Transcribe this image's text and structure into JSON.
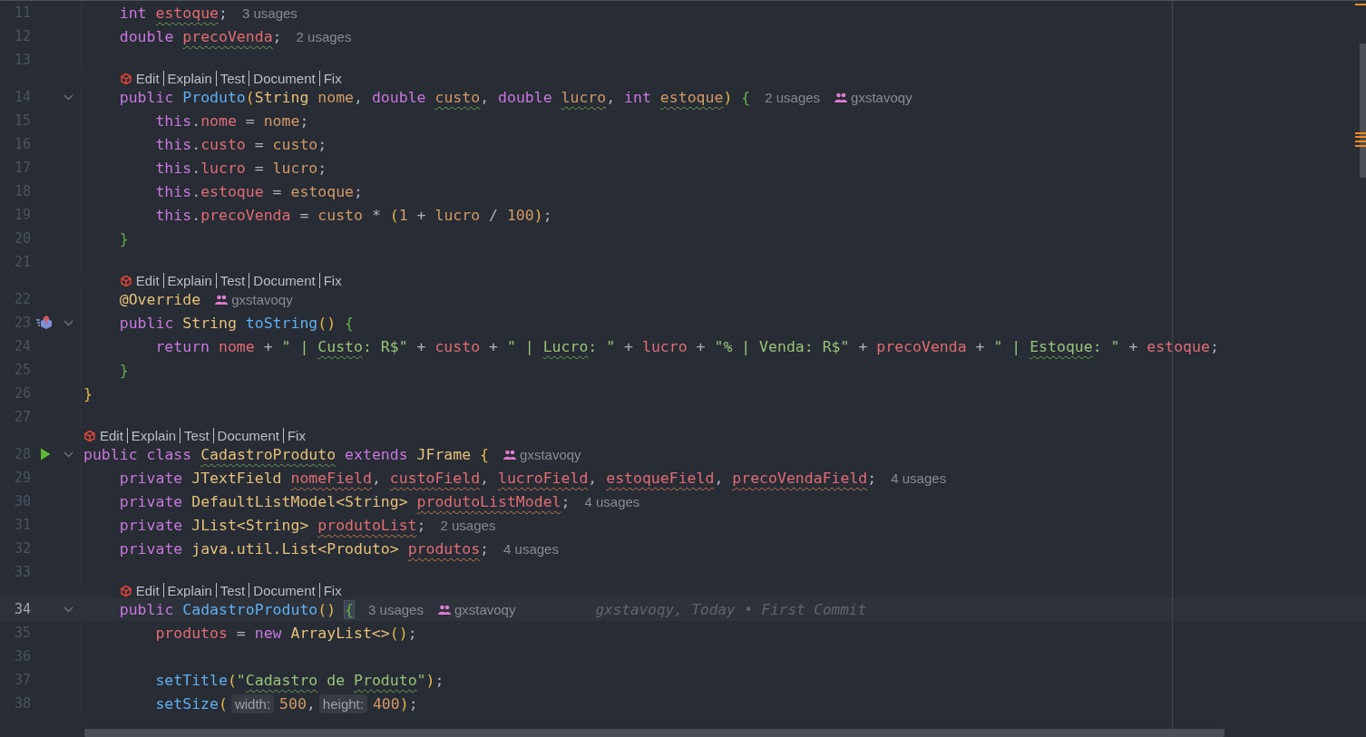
{
  "editor": {
    "lines": [
      {
        "kind": "code",
        "number": "11",
        "foldable": false,
        "current": false,
        "parts": [
          {
            "kind": "code",
            "tokens": [
              {
                "text": "    int ",
                "kind": "keyword"
              },
              {
                "text": "estoque",
                "kind": "field",
                "misspelled": true
              },
              {
                "text": ";",
                "kind": "plain"
              }
            ]
          },
          {
            "kind": "usages",
            "text": "3 usages"
          }
        ]
      },
      {
        "kind": "code",
        "number": "12",
        "foldable": false,
        "current": false,
        "parts": [
          {
            "kind": "code",
            "tokens": [
              {
                "text": "    double ",
                "kind": "keyword"
              },
              {
                "text": "precoVenda",
                "kind": "field",
                "misspelled": true
              },
              {
                "text": ";",
                "kind": "plain"
              }
            ]
          },
          {
            "kind": "usages",
            "text": "2 usages"
          }
        ]
      },
      {
        "kind": "code",
        "number": "13",
        "foldable": false,
        "current": false
      },
      {
        "kind": "lens",
        "actions": [
          "Edit",
          "Explain",
          "Test",
          "Document",
          "Fix"
        ]
      },
      {
        "kind": "code",
        "number": "14",
        "foldable": true,
        "current": false,
        "parts": [
          {
            "kind": "code",
            "tokens": [
              {
                "text": "    public ",
                "kind": "keyword"
              },
              {
                "text": "Produto",
                "kind": "method"
              },
              {
                "text": "(",
                "kind": "bracket"
              },
              {
                "text": "String ",
                "kind": "type"
              },
              {
                "text": "nome",
                "kind": "param"
              },
              {
                "text": ", ",
                "kind": "plain"
              },
              {
                "text": "double ",
                "kind": "keyword"
              },
              {
                "text": "custo",
                "kind": "param",
                "misspelled": true
              },
              {
                "text": ", ",
                "kind": "plain"
              },
              {
                "text": "double ",
                "kind": "keyword"
              },
              {
                "text": "lucro",
                "kind": "param",
                "misspelled": true
              },
              {
                "text": ", ",
                "kind": "plain"
              },
              {
                "text": "int ",
                "kind": "keyword"
              },
              {
                "text": "estoque",
                "kind": "param",
                "misspelled": true
              },
              {
                "text": ") ",
                "kind": "bracket"
              },
              {
                "text": "{",
                "kind": "brace"
              }
            ]
          },
          {
            "kind": "usages",
            "text": "2 usages"
          },
          {
            "kind": "author",
            "text": "gxstavoqy"
          }
        ]
      },
      {
        "kind": "code",
        "number": "15",
        "foldable": false,
        "current": false,
        "parts": [
          {
            "kind": "code",
            "tokens": [
              {
                "text": "        this",
                "kind": "keyword"
              },
              {
                "text": ".",
                "kind": "plain"
              },
              {
                "text": "nome",
                "kind": "field"
              },
              {
                "text": " = ",
                "kind": "plain"
              },
              {
                "text": "nome",
                "kind": "param"
              },
              {
                "text": ";",
                "kind": "plain"
              }
            ]
          }
        ]
      },
      {
        "kind": "code",
        "number": "16",
        "foldable": false,
        "current": false,
        "parts": [
          {
            "kind": "code",
            "tokens": [
              {
                "text": "        this",
                "kind": "keyword"
              },
              {
                "text": ".",
                "kind": "plain"
              },
              {
                "text": "custo",
                "kind": "field"
              },
              {
                "text": " = ",
                "kind": "plain"
              },
              {
                "text": "custo",
                "kind": "param"
              },
              {
                "text": ";",
                "kind": "plain"
              }
            ]
          }
        ]
      },
      {
        "kind": "code",
        "number": "17",
        "foldable": false,
        "current": false,
        "parts": [
          {
            "kind": "code",
            "tokens": [
              {
                "text": "        this",
                "kind": "keyword"
              },
              {
                "text": ".",
                "kind": "plain"
              },
              {
                "text": "lucro",
                "kind": "field"
              },
              {
                "text": " = ",
                "kind": "plain"
              },
              {
                "text": "lucro",
                "kind": "param"
              },
              {
                "text": ";",
                "kind": "plain"
              }
            ]
          }
        ]
      },
      {
        "kind": "code",
        "number": "18",
        "foldable": false,
        "current": false,
        "parts": [
          {
            "kind": "code",
            "tokens": [
              {
                "text": "        this",
                "kind": "keyword"
              },
              {
                "text": ".",
                "kind": "plain"
              },
              {
                "text": "estoque",
                "kind": "field"
              },
              {
                "text": " = ",
                "kind": "plain"
              },
              {
                "text": "estoque",
                "kind": "param"
              },
              {
                "text": ";",
                "kind": "plain"
              }
            ]
          }
        ]
      },
      {
        "kind": "code",
        "number": "19",
        "foldable": false,
        "current": false,
        "parts": [
          {
            "kind": "code",
            "tokens": [
              {
                "text": "        this",
                "kind": "keyword"
              },
              {
                "text": ".",
                "kind": "plain"
              },
              {
                "text": "precoVenda",
                "kind": "field"
              },
              {
                "text": " = ",
                "kind": "plain"
              },
              {
                "text": "custo ",
                "kind": "param"
              },
              {
                "text": "* ",
                "kind": "plain"
              },
              {
                "text": "(",
                "kind": "bracket"
              },
              {
                "text": "1 ",
                "kind": "number"
              },
              {
                "text": "+ ",
                "kind": "plain"
              },
              {
                "text": "lucro ",
                "kind": "param"
              },
              {
                "text": "/ ",
                "kind": "plain"
              },
              {
                "text": "100",
                "kind": "number"
              },
              {
                "text": ")",
                "kind": "bracket"
              },
              {
                "text": ";",
                "kind": "plain"
              }
            ]
          }
        ]
      },
      {
        "kind": "code",
        "number": "20",
        "foldable": false,
        "current": false,
        "parts": [
          {
            "kind": "code",
            "tokens": [
              {
                "text": "    }",
                "kind": "brace"
              }
            ]
          }
        ]
      },
      {
        "kind": "code",
        "number": "21",
        "foldable": false,
        "current": false
      },
      {
        "kind": "lens",
        "actions": [
          "Edit",
          "Explain",
          "Test",
          "Document",
          "Fix"
        ]
      },
      {
        "kind": "code",
        "number": "22",
        "foldable": false,
        "current": false,
        "parts": [
          {
            "kind": "code",
            "tokens": [
              {
                "text": "    @Override",
                "kind": "annotation"
              }
            ]
          },
          {
            "kind": "author",
            "text": "gxstavoqy"
          }
        ]
      },
      {
        "kind": "code",
        "number": "23",
        "foldable": true,
        "current": false,
        "gutter_icon": {
          "kind": "override"
        },
        "parts": [
          {
            "kind": "code",
            "tokens": [
              {
                "text": "    public ",
                "kind": "keyword"
              },
              {
                "text": "String ",
                "kind": "type"
              },
              {
                "text": "toString",
                "kind": "method"
              },
              {
                "text": "() ",
                "kind": "bracket"
              },
              {
                "text": "{",
                "kind": "brace"
              }
            ]
          }
        ]
      },
      {
        "kind": "code",
        "number": "24",
        "foldable": false,
        "current": false,
        "parts": [
          {
            "kind": "code",
            "tokens": [
              {
                "text": "        return ",
                "kind": "keyword"
              },
              {
                "text": "nome ",
                "kind": "field"
              },
              {
                "text": "+ ",
                "kind": "plain"
              },
              {
                "text": "\" | ",
                "kind": "string"
              },
              {
                "text": "Custo",
                "kind": "string",
                "misspelled": true
              },
              {
                "text": ": R$\" ",
                "kind": "string"
              },
              {
                "text": "+ ",
                "kind": "plain"
              },
              {
                "text": "custo ",
                "kind": "field"
              },
              {
                "text": "+ ",
                "kind": "plain"
              },
              {
                "text": "\" | ",
                "kind": "string"
              },
              {
                "text": "Lucro",
                "kind": "string",
                "misspelled": true
              },
              {
                "text": ": \" ",
                "kind": "string"
              },
              {
                "text": "+ ",
                "kind": "plain"
              },
              {
                "text": "lucro ",
                "kind": "field"
              },
              {
                "text": "+ ",
                "kind": "plain"
              },
              {
                "text": "\"% | Venda: R$\" ",
                "kind": "string"
              },
              {
                "text": "+ ",
                "kind": "plain"
              },
              {
                "text": "precoVenda ",
                "kind": "field"
              },
              {
                "text": "+ ",
                "kind": "plain"
              },
              {
                "text": "\" | ",
                "kind": "string"
              },
              {
                "text": "Estoque",
                "kind": "string",
                "misspelled": true
              },
              {
                "text": ": \" ",
                "kind": "string"
              },
              {
                "text": "+ ",
                "kind": "plain"
              },
              {
                "text": "estoque",
                "kind": "field"
              },
              {
                "text": ";",
                "kind": "plain"
              }
            ]
          }
        ]
      },
      {
        "kind": "code",
        "number": "25",
        "foldable": false,
        "current": false,
        "parts": [
          {
            "kind": "code",
            "tokens": [
              {
                "text": "    }",
                "kind": "brace"
              }
            ]
          }
        ]
      },
      {
        "kind": "code",
        "number": "26",
        "foldable": false,
        "current": false,
        "parts": [
          {
            "kind": "code",
            "tokens": [
              {
                "text": "}",
                "kind": "bracket"
              }
            ]
          }
        ]
      },
      {
        "kind": "code",
        "number": "27",
        "foldable": false,
        "current": false
      },
      {
        "kind": "lens",
        "actions": [
          "Edit",
          "Explain",
          "Test",
          "Document",
          "Fix"
        ]
      },
      {
        "kind": "code",
        "number": "28",
        "foldable": true,
        "current": false,
        "gutter_icon": {
          "kind": "run"
        },
        "parts": [
          {
            "kind": "code",
            "tokens": [
              {
                "text": "public class ",
                "kind": "keyword"
              },
              {
                "text": "CadastroProduto",
                "kind": "type",
                "misspelled": true
              },
              {
                "text": " extends ",
                "kind": "keyword"
              },
              {
                "text": "JFrame ",
                "kind": "type"
              },
              {
                "text": "{",
                "kind": "bracket"
              }
            ]
          },
          {
            "kind": "author",
            "text": "gxstavoqy"
          }
        ]
      },
      {
        "kind": "code",
        "number": "29",
        "foldable": false,
        "current": false,
        "parts": [
          {
            "kind": "code",
            "tokens": [
              {
                "text": "    private ",
                "kind": "keyword"
              },
              {
                "text": "JTextField ",
                "kind": "type"
              },
              {
                "text": "nomeField",
                "kind": "field",
                "warning": true
              },
              {
                "text": ", ",
                "kind": "plain"
              },
              {
                "text": "custoField",
                "kind": "field",
                "warning": true
              },
              {
                "text": ", ",
                "kind": "plain"
              },
              {
                "text": "lucroField",
                "kind": "field",
                "warning": true
              },
              {
                "text": ", ",
                "kind": "plain"
              },
              {
                "text": "estoqueField",
                "kind": "field",
                "warning": true
              },
              {
                "text": ", ",
                "kind": "plain"
              },
              {
                "text": "precoVendaField",
                "kind": "field",
                "warning": true
              },
              {
                "text": ";",
                "kind": "plain"
              }
            ]
          },
          {
            "kind": "usages",
            "text": "4 usages"
          }
        ]
      },
      {
        "kind": "code",
        "number": "30",
        "foldable": false,
        "current": false,
        "parts": [
          {
            "kind": "code",
            "tokens": [
              {
                "text": "    private ",
                "kind": "keyword"
              },
              {
                "text": "DefaultListModel<String> ",
                "kind": "type"
              },
              {
                "text": "produtoListModel",
                "kind": "field",
                "warning": true
              },
              {
                "text": ";",
                "kind": "plain"
              }
            ]
          },
          {
            "kind": "usages",
            "text": "4 usages"
          }
        ]
      },
      {
        "kind": "code",
        "number": "31",
        "foldable": false,
        "current": false,
        "parts": [
          {
            "kind": "code",
            "tokens": [
              {
                "text": "    private ",
                "kind": "keyword"
              },
              {
                "text": "JList<String> ",
                "kind": "type"
              },
              {
                "text": "produtoList",
                "kind": "field",
                "warning": true
              },
              {
                "text": ";",
                "kind": "plain"
              }
            ]
          },
          {
            "kind": "usages",
            "text": "2 usages"
          }
        ]
      },
      {
        "kind": "code",
        "number": "32",
        "foldable": false,
        "current": false,
        "parts": [
          {
            "kind": "code",
            "tokens": [
              {
                "text": "    private ",
                "kind": "keyword"
              },
              {
                "text": "java.util.List<Produto> ",
                "kind": "type"
              },
              {
                "text": "produtos",
                "kind": "field",
                "warning": true
              },
              {
                "text": ";",
                "kind": "plain"
              }
            ]
          },
          {
            "kind": "usages",
            "text": "4 usages"
          }
        ]
      },
      {
        "kind": "code",
        "number": "33",
        "foldable": false,
        "current": false
      },
      {
        "kind": "lens",
        "actions": [
          "Edit",
          "Explain",
          "Test",
          "Document",
          "Fix"
        ]
      },
      {
        "kind": "code",
        "number": "34",
        "foldable": true,
        "current": true,
        "parts": [
          {
            "kind": "code",
            "tokens": [
              {
                "text": "    public ",
                "kind": "keyword"
              },
              {
                "text": "CadastroProduto",
                "kind": "method"
              },
              {
                "text": "() ",
                "kind": "bracket"
              },
              {
                "text": "{",
                "kind": "brace",
                "matched": true
              }
            ]
          },
          {
            "kind": "usages",
            "text": "3 usages"
          },
          {
            "kind": "author",
            "text": "gxstavoqy"
          },
          {
            "kind": "blame",
            "text": "gxstavoqy, Today • First Commit"
          }
        ]
      },
      {
        "kind": "code",
        "number": "35",
        "foldable": false,
        "current": false,
        "parts": [
          {
            "kind": "code",
            "tokens": [
              {
                "text": "        produtos ",
                "kind": "field"
              },
              {
                "text": "= ",
                "kind": "plain"
              },
              {
                "text": "new ",
                "kind": "keyword"
              },
              {
                "text": "ArrayList<>",
                "kind": "type"
              },
              {
                "text": "()",
                "kind": "bracket"
              },
              {
                "text": ";",
                "kind": "plain"
              }
            ]
          }
        ]
      },
      {
        "kind": "code",
        "number": "36",
        "foldable": false,
        "current": false
      },
      {
        "kind": "code",
        "number": "37",
        "foldable": false,
        "current": false,
        "parts": [
          {
            "kind": "code",
            "tokens": [
              {
                "text": "        setTitle",
                "kind": "method"
              },
              {
                "text": "(",
                "kind": "bracket"
              },
              {
                "text": "\"",
                "kind": "string"
              },
              {
                "text": "Cadastro",
                "kind": "string",
                "misspelled": true
              },
              {
                "text": " de ",
                "kind": "string"
              },
              {
                "text": "Produto",
                "kind": "string",
                "misspelled": true
              },
              {
                "text": "\"",
                "kind": "string"
              },
              {
                "text": ")",
                "kind": "bracket"
              },
              {
                "text": ";",
                "kind": "plain"
              }
            ]
          }
        ]
      },
      {
        "kind": "code",
        "number": "38",
        "foldable": false,
        "current": false,
        "parts": [
          {
            "kind": "code",
            "tokens": [
              {
                "text": "        setSize",
                "kind": "method"
              },
              {
                "text": "(",
                "kind": "bracket"
              }
            ]
          },
          {
            "kind": "param_hint",
            "text": "width:"
          },
          {
            "kind": "code",
            "tokens": [
              {
                "text": "500",
                "kind": "number"
              },
              {
                "text": ",",
                "kind": "plain"
              }
            ]
          },
          {
            "kind": "param_hint",
            "text": "height:"
          },
          {
            "kind": "code",
            "tokens": [
              {
                "text": "400",
                "kind": "number"
              },
              {
                "text": ")",
                "kind": "bracket"
              },
              {
                "text": ";",
                "kind": "plain"
              }
            ]
          }
        ]
      }
    ]
  }
}
